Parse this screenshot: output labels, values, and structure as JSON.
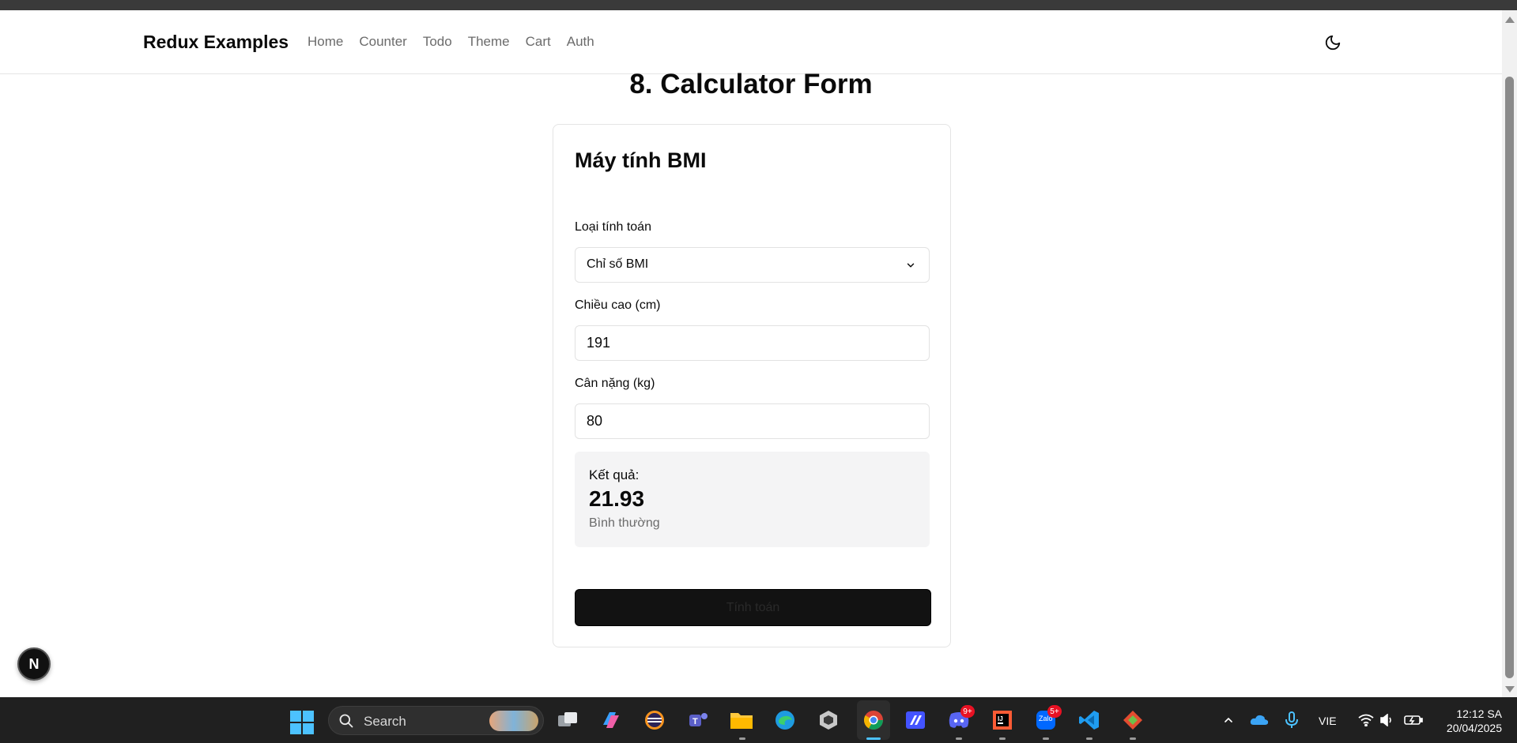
{
  "navbar": {
    "brand": "Redux Examples",
    "links": [
      "Home",
      "Counter",
      "Todo",
      "Theme",
      "Cart",
      "Auth"
    ],
    "theme_icon": "moon-icon"
  },
  "page": {
    "title": "8. Calculator Form"
  },
  "card": {
    "title": "Máy tính BMI",
    "type_label": "Loại tính toán",
    "type_value": "Chỉ số BMI",
    "height_label": "Chiều cao (cm)",
    "height_value": "191",
    "weight_label": "Cân nặng (kg)",
    "weight_value": "80",
    "result_label": "Kết quả:",
    "result_value": "21.93",
    "result_status": "Bình thường",
    "submit_label": "Tính toán"
  },
  "dev_badge": {
    "label": "N"
  },
  "taskbar": {
    "search_label": "Search",
    "language": "VIE",
    "time": "12:12 SA",
    "date": "20/04/2025",
    "discord_badge": "9+",
    "zalo_badge": "5+",
    "zalo_label": "Zalo"
  },
  "colors": {
    "accent": "#121212",
    "muted_text": "#6b6b6b",
    "result_bg": "#f4f4f5",
    "taskbar_bg": "#202020"
  }
}
